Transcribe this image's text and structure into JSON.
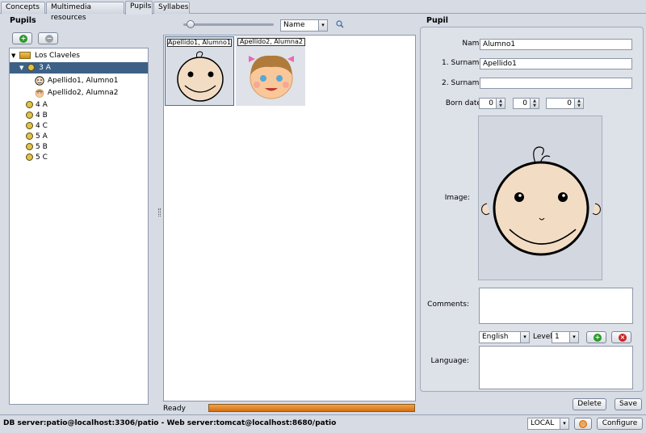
{
  "tabs": [
    "Concepts",
    "Multimedia resources",
    "Pupils",
    "Syllabes"
  ],
  "left_panel": {
    "title": "Pupils",
    "tree": {
      "root": "Los Claveles",
      "groups": [
        "3 A",
        "4 A",
        "4 B",
        "4 C",
        "5 A",
        "5 B",
        "5 C"
      ],
      "pupils": [
        "Apellido1, Alumno1",
        "Apellido2, Alumna2"
      ]
    }
  },
  "center": {
    "sort_value": "Name",
    "thumbs": [
      "Apellido1, Alumno1",
      "Apellido2, Alumna2"
    ],
    "status": "Ready"
  },
  "right_panel": {
    "title": "Pupil",
    "labels": {
      "name": "Name:",
      "surname1": "1. Surname:",
      "surname2": "2. Surname:",
      "born": "Born date::",
      "image": "Image:",
      "comments": "Comments:",
      "language": "Language:",
      "level": "Level:"
    },
    "name": "Alumno1",
    "surname1": "Apellido1",
    "surname2": "",
    "born": [
      "0",
      "0",
      "0"
    ],
    "language_value": "English",
    "level_value": "1",
    "delete_label": "Delete",
    "save_label": "Save"
  },
  "footer": {
    "status": "DB server:patio@localhost:3306/patio - Web server:tomcat@localhost:8680/patio",
    "mode": "LOCAL",
    "configure_label": "Configure"
  },
  "colors": {
    "selection": "#3d6186",
    "progress": "#e07b17",
    "add": "#2a9a2a",
    "remove": "#cc2222"
  }
}
